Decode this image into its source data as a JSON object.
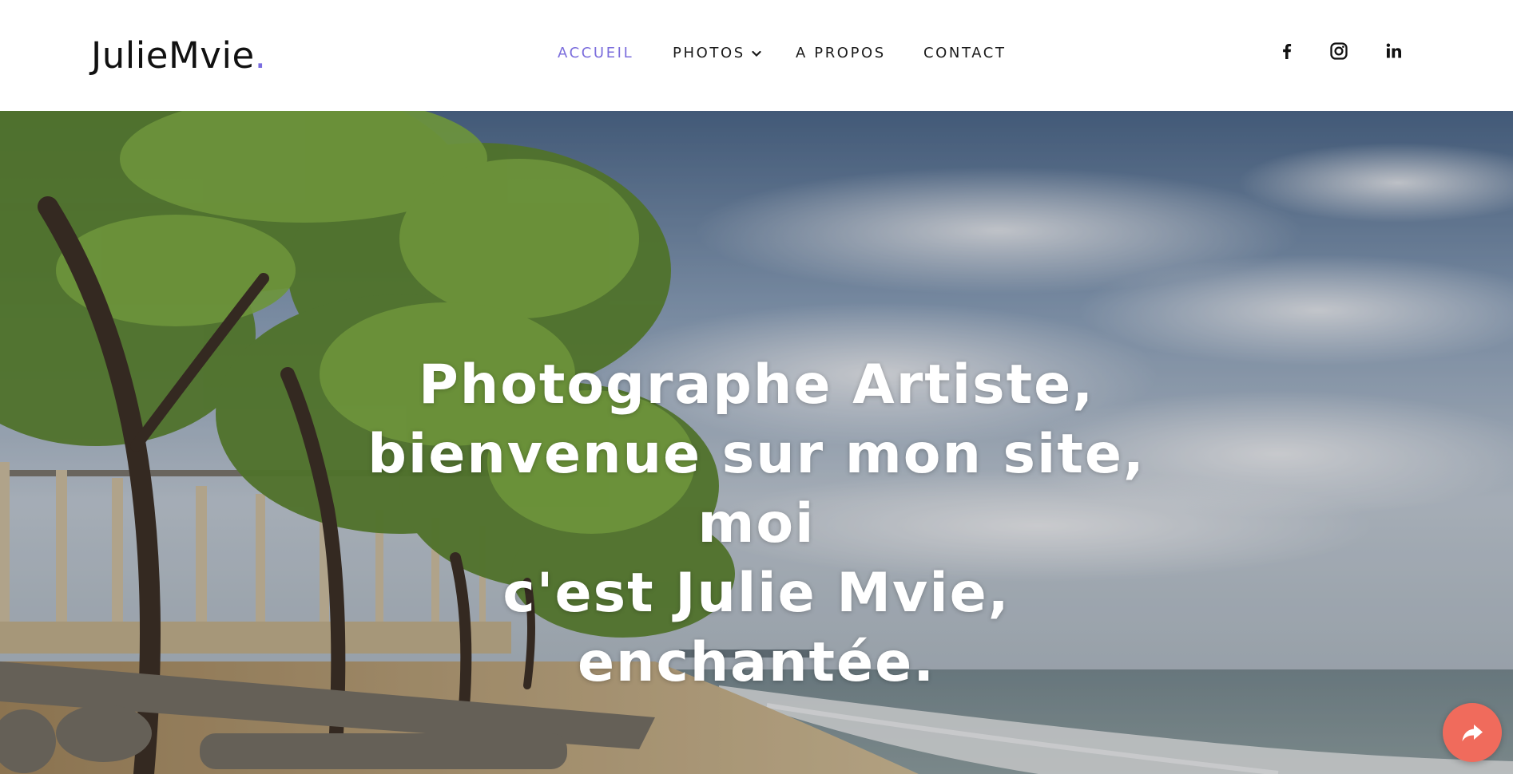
{
  "header": {
    "logo_text": "JulieMvie",
    "logo_dot": "."
  },
  "nav": {
    "items": [
      {
        "label": "ACCUEIL",
        "active": true
      },
      {
        "label": "PHOTOS",
        "has_dropdown": true
      },
      {
        "label": "A PROPOS"
      },
      {
        "label": "CONTACT"
      }
    ]
  },
  "social": [
    {
      "icon": "facebook-icon"
    },
    {
      "icon": "instagram-icon"
    },
    {
      "icon": "linkedin-icon"
    }
  ],
  "hero": {
    "title_line1": "Photographe Artiste,",
    "title_line2": "bienvenue sur mon site, moi",
    "title_line3": "c'est Julie Mvie, enchantée."
  },
  "share_button": {
    "icon": "share-icon"
  },
  "colors": {
    "accent": "#7b6ddc",
    "share_button": "#f06b5c",
    "text": "#1a1a1a"
  }
}
